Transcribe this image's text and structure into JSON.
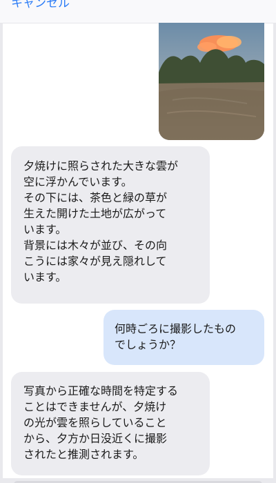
{
  "header": {
    "cancel_label": "キャンセル"
  },
  "photo": {
    "icon": "sunset-photo"
  },
  "messages": [
    {
      "role": "assistant",
      "text": "夕焼けに照らされた大きな雲が\n空に浮かんでいます。\nその下には、茶色と緑の草が\n生えた開けた土地が広がって\nいます。\n背景には木々が並び、その向\nこうには家々が見え隠れして\nいます。"
    },
    {
      "role": "user",
      "text": "何時ごろに撮影したもの\nでしょうか？"
    },
    {
      "role": "assistant",
      "text": "写真から正確な時間を特定する\nことはできませんが、夕焼け\nの光が雲を照らしていること\nから、夕方か日没近くに撮影\nされたと推測されます。"
    }
  ],
  "colors": {
    "accent": "#2b7cf6",
    "incoming_bubble": "#ececf0",
    "outgoing_bubble": "#d8e6fb"
  }
}
